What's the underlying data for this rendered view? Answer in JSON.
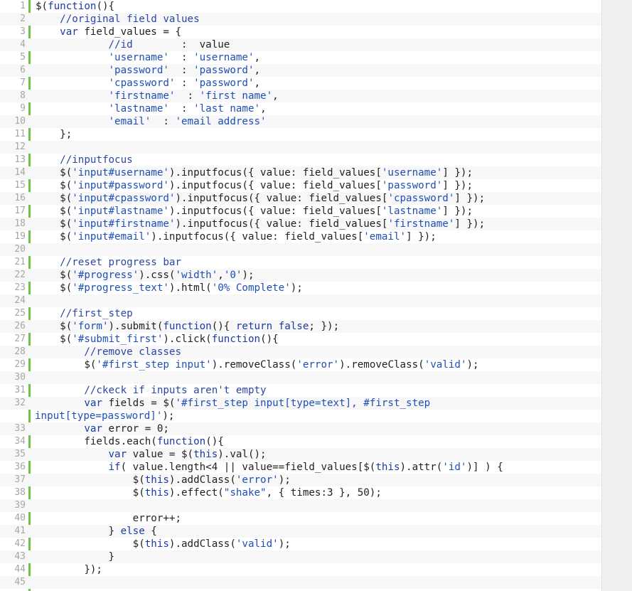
{
  "editor": {
    "lines": [
      {
        "n": "1",
        "t": [
          [
            "p",
            "$("
          ],
          [
            "k",
            "function"
          ],
          [
            "p",
            "(){"
          ]
        ]
      },
      {
        "n": "2",
        "t": [
          [
            "p",
            "    "
          ],
          [
            "c",
            "//original field values"
          ]
        ]
      },
      {
        "n": "3",
        "t": [
          [
            "p",
            "    "
          ],
          [
            "k",
            "var"
          ],
          [
            "p",
            " field_values = {"
          ]
        ]
      },
      {
        "n": "4",
        "t": [
          [
            "p",
            "            "
          ],
          [
            "c",
            "//id"
          ],
          [
            "p",
            "        :  value"
          ]
        ]
      },
      {
        "n": "5",
        "t": [
          [
            "p",
            "            "
          ],
          [
            "s",
            "'username'"
          ],
          [
            "p",
            "  : "
          ],
          [
            "s",
            "'username'"
          ],
          [
            "p",
            ","
          ]
        ]
      },
      {
        "n": "6",
        "t": [
          [
            "p",
            "            "
          ],
          [
            "s",
            "'password'"
          ],
          [
            "p",
            "  : "
          ],
          [
            "s",
            "'password'"
          ],
          [
            "p",
            ","
          ]
        ]
      },
      {
        "n": "7",
        "t": [
          [
            "p",
            "            "
          ],
          [
            "s",
            "'cpassword'"
          ],
          [
            "p",
            " : "
          ],
          [
            "s",
            "'password'"
          ],
          [
            "p",
            ","
          ]
        ]
      },
      {
        "n": "8",
        "t": [
          [
            "p",
            "            "
          ],
          [
            "s",
            "'firstname'"
          ],
          [
            "p",
            "  : "
          ],
          [
            "s",
            "'first name'"
          ],
          [
            "p",
            ","
          ]
        ]
      },
      {
        "n": "9",
        "t": [
          [
            "p",
            "            "
          ],
          [
            "s",
            "'lastname'"
          ],
          [
            "p",
            "  : "
          ],
          [
            "s",
            "'last name'"
          ],
          [
            "p",
            ","
          ]
        ]
      },
      {
        "n": "10",
        "t": [
          [
            "p",
            "            "
          ],
          [
            "s",
            "'email'"
          ],
          [
            "p",
            "  : "
          ],
          [
            "s",
            "'email address'"
          ]
        ]
      },
      {
        "n": "11",
        "t": [
          [
            "p",
            "    };"
          ]
        ]
      },
      {
        "n": "12",
        "t": []
      },
      {
        "n": "13",
        "t": [
          [
            "p",
            "    "
          ],
          [
            "c",
            "//inputfocus"
          ]
        ]
      },
      {
        "n": "14",
        "t": [
          [
            "p",
            "    $("
          ],
          [
            "s",
            "'input#username'"
          ],
          [
            "p",
            ").inputfocus({ value: field_values["
          ],
          [
            "s",
            "'username'"
          ],
          [
            "p",
            "] });"
          ]
        ]
      },
      {
        "n": "15",
        "t": [
          [
            "p",
            "    $("
          ],
          [
            "s",
            "'input#password'"
          ],
          [
            "p",
            ").inputfocus({ value: field_values["
          ],
          [
            "s",
            "'password'"
          ],
          [
            "p",
            "] });"
          ]
        ]
      },
      {
        "n": "16",
        "t": [
          [
            "p",
            "    $("
          ],
          [
            "s",
            "'input#cpassword'"
          ],
          [
            "p",
            ").inputfocus({ value: field_values["
          ],
          [
            "s",
            "'cpassword'"
          ],
          [
            "p",
            "] });"
          ]
        ]
      },
      {
        "n": "17",
        "t": [
          [
            "p",
            "    $("
          ],
          [
            "s",
            "'input#lastname'"
          ],
          [
            "p",
            ").inputfocus({ value: field_values["
          ],
          [
            "s",
            "'lastname'"
          ],
          [
            "p",
            "] });"
          ]
        ]
      },
      {
        "n": "18",
        "t": [
          [
            "p",
            "    $("
          ],
          [
            "s",
            "'input#firstname'"
          ],
          [
            "p",
            ").inputfocus({ value: field_values["
          ],
          [
            "s",
            "'firstname'"
          ],
          [
            "p",
            "] });"
          ]
        ]
      },
      {
        "n": "19",
        "t": [
          [
            "p",
            "    $("
          ],
          [
            "s",
            "'input#email'"
          ],
          [
            "p",
            ").inputfocus({ value: field_values["
          ],
          [
            "s",
            "'email'"
          ],
          [
            "p",
            "] });"
          ]
        ]
      },
      {
        "n": "20",
        "t": []
      },
      {
        "n": "21",
        "t": [
          [
            "p",
            "    "
          ],
          [
            "c",
            "//reset progress bar"
          ]
        ]
      },
      {
        "n": "22",
        "t": [
          [
            "p",
            "    $("
          ],
          [
            "s",
            "'#progress'"
          ],
          [
            "p",
            ").css("
          ],
          [
            "s",
            "'width'"
          ],
          [
            "p",
            ","
          ],
          [
            "s",
            "'0'"
          ],
          [
            "p",
            ");"
          ]
        ]
      },
      {
        "n": "23",
        "t": [
          [
            "p",
            "    $("
          ],
          [
            "s",
            "'#progress_text'"
          ],
          [
            "p",
            ").html("
          ],
          [
            "s",
            "'0% Complete'"
          ],
          [
            "p",
            ");"
          ]
        ]
      },
      {
        "n": "24",
        "t": []
      },
      {
        "n": "25",
        "t": [
          [
            "p",
            "    "
          ],
          [
            "c",
            "//first_step"
          ]
        ]
      },
      {
        "n": "26",
        "t": [
          [
            "p",
            "    $("
          ],
          [
            "s",
            "'form'"
          ],
          [
            "p",
            ").submit("
          ],
          [
            "k",
            "function"
          ],
          [
            "p",
            "(){ "
          ],
          [
            "k",
            "return"
          ],
          [
            "p",
            " "
          ],
          [
            "k",
            "false"
          ],
          [
            "p",
            "; });"
          ]
        ]
      },
      {
        "n": "27",
        "t": [
          [
            "p",
            "    $("
          ],
          [
            "s",
            "'#submit_first'"
          ],
          [
            "p",
            ").click("
          ],
          [
            "k",
            "function"
          ],
          [
            "p",
            "(){"
          ]
        ]
      },
      {
        "n": "28",
        "t": [
          [
            "p",
            "        "
          ],
          [
            "c",
            "//remove classes"
          ]
        ]
      },
      {
        "n": "29",
        "t": [
          [
            "p",
            "        $("
          ],
          [
            "s",
            "'#first_step input'"
          ],
          [
            "p",
            ").removeClass("
          ],
          [
            "s",
            "'error'"
          ],
          [
            "p",
            ").removeClass("
          ],
          [
            "s",
            "'valid'"
          ],
          [
            "p",
            ");"
          ]
        ]
      },
      {
        "n": "30",
        "t": []
      },
      {
        "n": "31",
        "t": [
          [
            "p",
            "        "
          ],
          [
            "c",
            "//ckeck if inputs aren't empty"
          ]
        ]
      },
      {
        "n": "32",
        "t": [
          [
            "p",
            "        "
          ],
          [
            "k",
            "var"
          ],
          [
            "p",
            " fields = $("
          ],
          [
            "s",
            "'#first_step input[type=text], #first_step"
          ]
        ]
      },
      {
        "n": "",
        "t": [
          [
            "s",
            "input[type=password]'"
          ],
          [
            "p",
            ");"
          ]
        ]
      },
      {
        "n": "33",
        "t": [
          [
            "p",
            "        "
          ],
          [
            "k",
            "var"
          ],
          [
            "p",
            " error = 0;"
          ]
        ]
      },
      {
        "n": "34",
        "t": [
          [
            "p",
            "        fields.each("
          ],
          [
            "k",
            "function"
          ],
          [
            "p",
            "(){"
          ]
        ]
      },
      {
        "n": "35",
        "t": [
          [
            "p",
            "            "
          ],
          [
            "k",
            "var"
          ],
          [
            "p",
            " value = $("
          ],
          [
            "k",
            "this"
          ],
          [
            "p",
            ").val();"
          ]
        ]
      },
      {
        "n": "36",
        "t": [
          [
            "p",
            "            "
          ],
          [
            "k",
            "if"
          ],
          [
            "p",
            "( value.length<4 || value==field_values[$("
          ],
          [
            "k",
            "this"
          ],
          [
            "p",
            ").attr("
          ],
          [
            "s",
            "'id'"
          ],
          [
            "p",
            ")] ) {"
          ]
        ]
      },
      {
        "n": "37",
        "t": [
          [
            "p",
            "                $("
          ],
          [
            "k",
            "this"
          ],
          [
            "p",
            ").addClass("
          ],
          [
            "s",
            "'error'"
          ],
          [
            "p",
            ");"
          ]
        ]
      },
      {
        "n": "38",
        "t": [
          [
            "p",
            "                $("
          ],
          [
            "k",
            "this"
          ],
          [
            "p",
            ").effect("
          ],
          [
            "s",
            "\"shake\""
          ],
          [
            "p",
            ", { times:3 }, 50);"
          ]
        ]
      },
      {
        "n": "39",
        "t": []
      },
      {
        "n": "40",
        "t": [
          [
            "p",
            "                error++;"
          ]
        ]
      },
      {
        "n": "41",
        "t": [
          [
            "p",
            "            } "
          ],
          [
            "k",
            "else"
          ],
          [
            "p",
            " {"
          ]
        ]
      },
      {
        "n": "42",
        "t": [
          [
            "p",
            "                $("
          ],
          [
            "k",
            "this"
          ],
          [
            "p",
            ").addClass("
          ],
          [
            "s",
            "'valid'"
          ],
          [
            "p",
            ");"
          ]
        ]
      },
      {
        "n": "43",
        "t": [
          [
            "p",
            "            }"
          ]
        ]
      },
      {
        "n": "44",
        "t": [
          [
            "p",
            "        });"
          ]
        ]
      },
      {
        "n": "45",
        "t": []
      }
    ],
    "colors": {
      "gutter_rule": "#6cc644",
      "keyword": "#1a3aa6",
      "string": "#1d4fb8",
      "comment": "#2a46a8",
      "line_number": "#a6a6a6",
      "alt_row": "#f7f7f7"
    }
  }
}
